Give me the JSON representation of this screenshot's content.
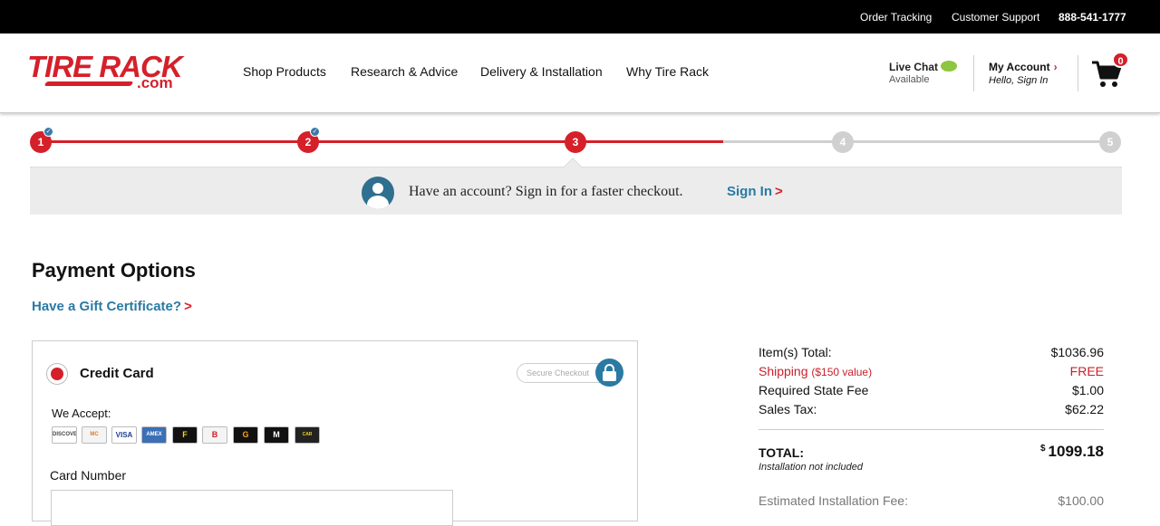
{
  "topbar": {
    "order_tracking": "Order Tracking",
    "customer_support": "Customer Support",
    "phone": "888-541-1777"
  },
  "header": {
    "logo_brand": "TIRE RACK",
    "logo_dotcom": ".com",
    "nav": [
      "Shop Products",
      "Research & Advice",
      "Delivery & Installation",
      "Why Tire Rack"
    ],
    "live_chat": "Live Chat",
    "live_chat_status": "Available",
    "account_title": "My Account",
    "account_sub": "Hello, Sign In",
    "cart_count": "0"
  },
  "steps": {
    "labels": [
      "1",
      "2",
      "3",
      "4",
      "5"
    ],
    "current": 3,
    "accent_color": "#d5202a",
    "inactive_color": "#d0d0d0",
    "check_icon": "check-icon"
  },
  "signin": {
    "message": "Have an account? Sign in for a faster checkout.",
    "link": "Sign In",
    "arrow": ">"
  },
  "payment": {
    "title": "Payment Options",
    "gift_link": "Have a Gift Certificate?",
    "gift_arrow": ">",
    "method_label": "Credit Card",
    "secure_label": "Secure Checkout",
    "we_accept": "We Accept:",
    "card_logos": [
      {
        "name": "discover-card-icon",
        "text": "DISCOVER"
      },
      {
        "name": "mastercard-icon",
        "text": "MC"
      },
      {
        "name": "visa-card-icon",
        "text": "VISA"
      },
      {
        "name": "amex-card-icon",
        "text": "AMEX"
      },
      {
        "name": "firestone-card-icon",
        "text": "F"
      },
      {
        "name": "bridgestone-card-icon",
        "text": "B"
      },
      {
        "name": "goodyear-card-icon",
        "text": "G"
      },
      {
        "name": "michelin-card-icon",
        "text": "M"
      },
      {
        "name": "car-care-card-icon",
        "text": "CAR CARE"
      }
    ],
    "card_number_label": "Card Number",
    "card_number_value": ""
  },
  "summary": {
    "items_total_label": "Item(s) Total:",
    "items_total_value": "$1036.96",
    "shipping_label": "Shipping",
    "shipping_note": "($150 value)",
    "shipping_value": "FREE",
    "state_fee_label": "Required State Fee",
    "state_fee_value": "$1.00",
    "sales_tax_label": "Sales Tax:",
    "sales_tax_value": "$62.22",
    "total_label": "TOTAL:",
    "total_currency": "$",
    "total_value": "1099.18",
    "install_note": "Installation not included",
    "est_install_label": "Estimated Installation Fee:",
    "est_install_value": "$100.00"
  }
}
